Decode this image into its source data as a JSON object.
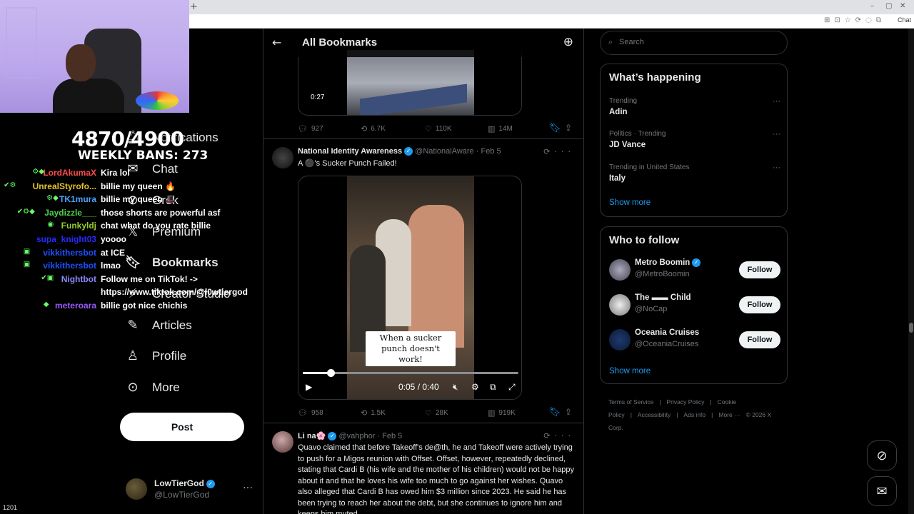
{
  "browser": {
    "new_tab": "+",
    "chat_label": "Chat",
    "min": "–",
    "max": "▢",
    "close": "✕"
  },
  "stream": {
    "counter": "4870/4900",
    "weekly_bans": "WEEKLY BANS: 273",
    "viewers": "1201",
    "chat": [
      {
        "user": "LordAkumaX",
        "badges": "⚙◆",
        "color": "#ff4d4d",
        "msg": "Kira lol"
      },
      {
        "user": "UnrealStyrofo...",
        "badges": "✔⚙",
        "color": "#e6c229",
        "msg": "billie my queen 🔥"
      },
      {
        "user": "TK1mura",
        "badges": "⚙◆",
        "color": "#4fa3ff",
        "msg": "billie my queen 🎩"
      },
      {
        "user": "Jaydizzle___",
        "badges": "✔⚙◆",
        "color": "#4fd14f",
        "msg": "those shorts are powerful asf"
      },
      {
        "user": "Funkyldj",
        "badges": "◉",
        "color": "#9acd32",
        "msg": "chat what do you rate billie"
      },
      {
        "user": "supa_knight03",
        "badges": "",
        "color": "#2a2aff",
        "msg": "yoooo"
      },
      {
        "user": "vikkithersbot",
        "badges": "▣",
        "color": "#1f4fff",
        "msg": "at ICE"
      },
      {
        "user": "vikkithersbot",
        "badges": "▣",
        "color": "#1f4fff",
        "msg": "lmao"
      },
      {
        "user": "Nightbot",
        "badges": "✔▣",
        "color": "#8a8aff",
        "msg": "Follow me on TikTok! ->"
      },
      {
        "user": "",
        "badges": "",
        "color": "#fff",
        "msg": "https://www.tiktok.com/@l0wtiergod"
      },
      {
        "user": "meteroara",
        "badges": "◆",
        "color": "#9b59ff",
        "msg": "billie got nice chichis"
      }
    ]
  },
  "nav": {
    "notifications": "Notifications",
    "chat": "Chat",
    "grok": "Grok",
    "premium": "Premium",
    "bookmarks": "Bookmarks",
    "creator_studio": "Creator Studio",
    "articles": "Articles",
    "profile": "Profile",
    "more": "More",
    "post": "Post",
    "user_name": "LowTierGod",
    "user_handle": "@LowTierGod",
    "icons": {
      "notifications": "bell-icon",
      "chat": "mail-icon",
      "grok": "grok-icon",
      "premium": "x-icon",
      "bookmarks": "bookmark-icon",
      "creator_studio": "lightning-icon",
      "articles": "article-icon",
      "profile": "person-icon",
      "more": "more-circle-icon"
    }
  },
  "timeline": {
    "title": "All Bookmarks",
    "tweets": [
      {
        "video_time": "0:27",
        "replies": "927",
        "reposts": "6.7K",
        "likes": "110K",
        "views": "14M"
      },
      {
        "name": "National Identity Awareness",
        "handle": "@NationalAware",
        "date": "· Feb 5",
        "text": "A ⚫'s Sucker Punch Failed!",
        "video_caption": "When a sucker punch doesn't work!",
        "video_time": "0:05 / 0:40",
        "progress": 0.13,
        "replies": "958",
        "reposts": "1.5K",
        "likes": "28K",
        "views": "919K"
      },
      {
        "name": "Li na🌸",
        "handle": "@vahphor",
        "date": "· Feb 5",
        "text": "Quavo claimed that before Takeoff's de@th, he and Takeoff were actively trying to push for a Migos reunion with Offset. Offset, however, repeatedly declined, stating that Cardi B (his wife and the mother of his children) would not be happy about it and that he loves his wife too much to go against her wishes. Quavo also alleged that Cardi B has owed him $3 million since 2023. He said he has been trying to reach her about the debt, but she continues to ignore him and keeps him muted."
      }
    ]
  },
  "sidebar": {
    "search_placeholder": "Search",
    "happening_title": "What’s happening",
    "trends": [
      {
        "context": "Trending",
        "topic": "Adin"
      },
      {
        "context": "Politics · Trending",
        "topic": "JD Vance"
      },
      {
        "context": "Trending in United States",
        "topic": "Italy"
      }
    ],
    "show_more": "Show more",
    "wtf_title": "Who to follow",
    "follow_label": "Follow",
    "suggestions": [
      {
        "name": "Metro Boomin",
        "handle": "@MetroBoomin",
        "verified": true
      },
      {
        "name": "The ▬▬ Child",
        "handle": "@NoCap",
        "verified": false
      },
      {
        "name": "Oceania Cruises",
        "handle": "@OceaniaCruises",
        "verified": false
      }
    ],
    "footer": [
      "Terms of Service",
      "|",
      "Privacy Policy",
      "|",
      "Cookie Policy",
      "|",
      "Accessibility",
      "|",
      "Ads info",
      "|",
      "More ···",
      "© 2026 X Corp."
    ]
  },
  "colors": {
    "accent": "#1d9bf0",
    "border": "#2f3336",
    "muted": "#71767b"
  }
}
